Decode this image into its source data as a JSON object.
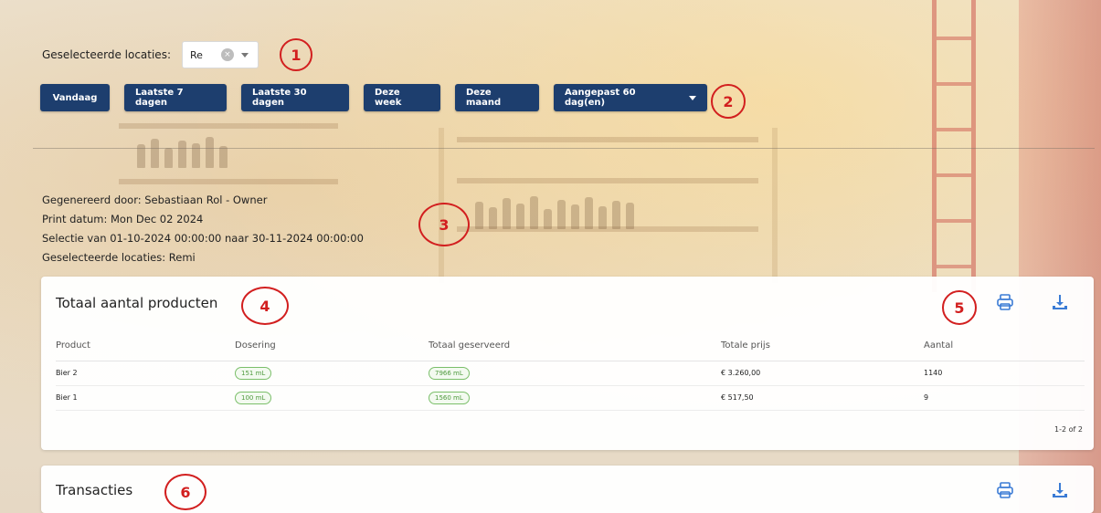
{
  "filters": {
    "locations_label": "Geselecteerde locaties:",
    "selected_location": "Re",
    "clear_icon": "×"
  },
  "range_buttons": {
    "today": "Vandaag",
    "last7": "Laatste 7 dagen",
    "last30": "Laatste 30 dagen",
    "this_week": "Deze week",
    "this_month": "Deze maand",
    "custom": "Aangepast 60 dag(en)"
  },
  "annotations": [
    "1",
    "2",
    "3",
    "4",
    "5",
    "6"
  ],
  "report_meta": {
    "generated_by": "Gegenereerd door: Sebastiaan Rol - Owner",
    "print_date": "Print datum: Mon Dec 02 2024",
    "selection": "Selectie van 01-10-2024 00:00:00 naar 30-11-2024 00:00:00",
    "locations": "Geselecteerde locaties: Remi"
  },
  "products_card": {
    "title": "Totaal aantal producten",
    "columns": {
      "product": "Product",
      "dosage": "Dosering",
      "total_served": "Totaal geserveerd",
      "total_price": "Totale prijs",
      "count": "Aantal"
    },
    "rows": [
      {
        "product": "Bier 2",
        "dosage": "151 mL",
        "total_served": "7966 mL",
        "total_price": "€ 3.260,00",
        "count": "1140"
      },
      {
        "product": "Bier 1",
        "dosage": "100 mL",
        "total_served": "1560 mL",
        "total_price": "€ 517,50",
        "count": "9"
      }
    ],
    "pagination": "1-2 of 2"
  },
  "transactions_card": {
    "title": "Transacties"
  },
  "icons": {
    "print": "printer-icon",
    "download": "download-icon"
  },
  "colors": {
    "primary_button": "#1d3e6e",
    "annotation": "#d21f1f",
    "chip_green": "#4f9a3e",
    "icon_blue": "#3a7bd5"
  }
}
